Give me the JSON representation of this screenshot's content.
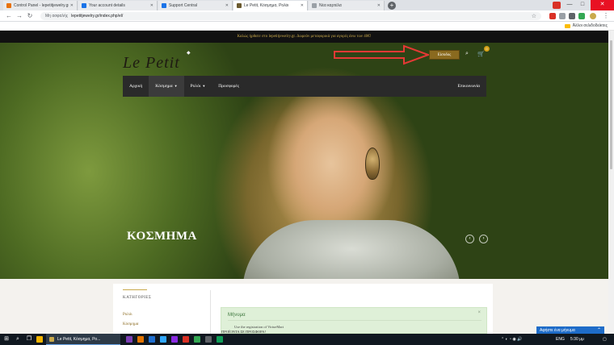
{
  "browser": {
    "tabs": [
      {
        "label": "Control Panel - lepetitjewelry.gr",
        "favicon_color": "#e8710a"
      },
      {
        "label": "Your account details",
        "favicon_color": "#1a73e8"
      },
      {
        "label": "Support Central",
        "favicon_color": "#1a73e8"
      },
      {
        "label": "Le Petit, Κόσμημα, Ρολόι",
        "favicon_color": "#6b5a2f"
      },
      {
        "label": "Νέα καρτέλα",
        "favicon_color": "#9aa0a6"
      }
    ],
    "new_tab_symbol": "+",
    "window_controls": {
      "minimize": "—",
      "maximize": "□",
      "close": "✕"
    },
    "nav": {
      "back": "←",
      "forward": "→",
      "reload": "↻"
    },
    "security_label": "Μη ασφαλής",
    "url": "lepetitjewelry.gr/index.php/el/",
    "star_icon": "☆",
    "other_bookmarks": "Άλλοι σελιδοδείκτες"
  },
  "site": {
    "promo_text": "Καλώς ήρθατε στο lepetitjewelry.gr. Δωρεάν μεταφορικά για αγορές άνω των 40€!",
    "logo_text": "Le Petit",
    "login_label": "Είσοδος",
    "cart_count": "0",
    "nav": {
      "home": "Αρχική",
      "jewelry": "Κόσμημα",
      "watches": "Ρολόι",
      "offers": "Προσφορές",
      "contact": "Επικοινωνία"
    },
    "hero_title": "ΚΟΣΜΗΜΑ",
    "prev": "‹",
    "next": "›",
    "categories_title": "ΚΑΤΗΓΟΡΙΕΣ",
    "categories": [
      "Ρολόι",
      "Κόσμημα"
    ],
    "message": {
      "title": "Μήνυμα",
      "close": "×",
      "line1": "Use the registration of VirtueMart",
      "line2": "ΠΡΟΪΟΝΤΑ ΣΕ ΠΡΟΣΦΟΡΑ!"
    }
  },
  "chat": {
    "label": "Αφήστε ένα μήνυμα",
    "chevron": "⌃"
  },
  "taskbar": {
    "task_label": "Le Petit, Κόσμημα, Ρο...",
    "language": "ENG",
    "time": "5:30 μμ"
  },
  "colors": {
    "gold": "#c9a94b",
    "nav_bg": "#2a2a2a",
    "login_bg": "#8a6a1f",
    "arrow": "#e53935"
  }
}
